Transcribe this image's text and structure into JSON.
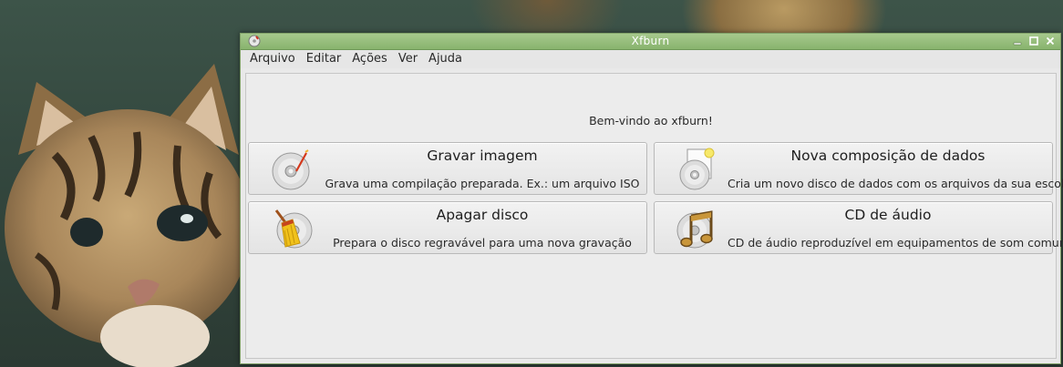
{
  "window": {
    "title": "Xfburn"
  },
  "menubar": {
    "items": [
      "Arquivo",
      "Editar",
      "Ações",
      "Ver",
      "Ajuda"
    ]
  },
  "main": {
    "welcome": "Bem-vindo ao xfburn!",
    "actions": [
      {
        "title": "Gravar imagem",
        "description": "Grava uma compilação preparada. Ex.: um arquivo ISO",
        "icon": "disc-burn-icon"
      },
      {
        "title": "Nova composição de dados",
        "description": "Cria um novo disco de dados com os arquivos da sua escolha",
        "icon": "data-composition-icon"
      },
      {
        "title": "Apagar disco",
        "description": "Prepara o disco regravável para uma nova gravação",
        "icon": "broom-disc-icon"
      },
      {
        "title": "CD de áudio",
        "description": "CD de áudio reproduzível em equipamentos de som comuns",
        "icon": "music-notes-icon"
      }
    ]
  },
  "colors": {
    "titlebar": "#88b36d",
    "window_bg": "#e9e9e9"
  }
}
